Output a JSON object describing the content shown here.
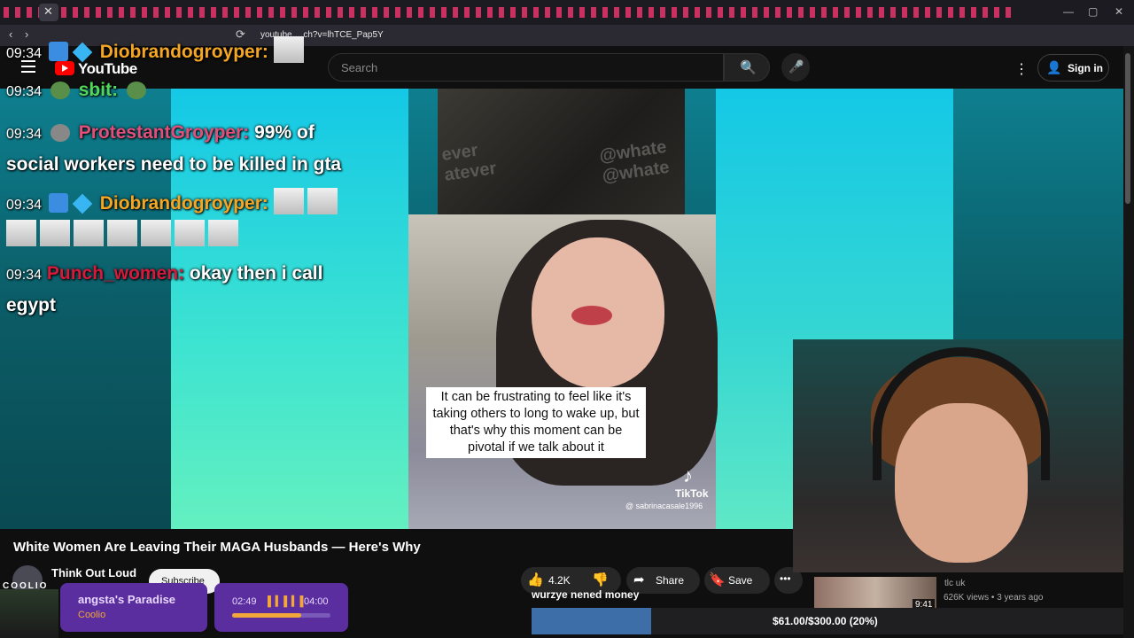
{
  "browser": {
    "url": "youtube.…ch?v=lhTCE_Pap5Y",
    "close_glyph": "✕",
    "back_glyph": "‹",
    "forward_glyph": "›",
    "reload_glyph": "⟳",
    "min_glyph": "—",
    "max_glyph": "▢",
    "win_close_glyph": "✕"
  },
  "youtube": {
    "logo": "YouTube",
    "search_placeholder": "Search",
    "search_icon": "🔍",
    "mic_icon": "🎤",
    "more_icon": "⋮",
    "signin_label": "Sign in",
    "signin_icon": "👤"
  },
  "video": {
    "top_text_left": "ever\natever",
    "top_text_right": "@whate\n@whate",
    "caption": "It can be frustrating to feel like it's taking others to long to wake up, but that's why this moment can be pivotal if we talk about it",
    "tiktok_brand": "TikTok",
    "tiktok_glyph": "♪",
    "tiktok_handle": "@ sabrinacasale1996"
  },
  "chat": [
    {
      "time": "09:34",
      "user": "Diobrandogroyper:",
      "message": ""
    },
    {
      "time": "09:34",
      "user": "sbit:",
      "message": ""
    },
    {
      "time": "09:34",
      "user": "ProtestantGroyper:",
      "message": "99% of",
      "message2": "social workers need to be killed in gta"
    },
    {
      "time": "09:34",
      "user": "Diobrandogroyper:",
      "message": ""
    },
    {
      "time": "09:34",
      "user": "Punch_women:",
      "message": "okay then i call",
      "message2": "egypt"
    }
  ],
  "meta": {
    "title": "White Women Are Leaving Their MAGA Husbands — Here's Why",
    "channel": "Think Out Loud",
    "subscribe": "Subscribe",
    "likes": "4.2K",
    "like_icon": "👍",
    "dislike_icon": "👎",
    "share": "Share",
    "share_icon": "➦",
    "save": "Save",
    "save_icon": "🔖",
    "more_icon": "•••"
  },
  "related": {
    "duration": "9:41",
    "channel": "tlc uk",
    "stats": "626K views • 3 years ago"
  },
  "music": {
    "cover_tag": "COOLIO",
    "song": "angsta's Paradise",
    "artist": "Coolio",
    "elapsed": "02:49",
    "total": "04:00",
    "wave": "▌▍▌▍▌",
    "progress": 0.7
  },
  "goal": {
    "name": "wurzye nened money",
    "text": "$61.00/$300.00 (20%)",
    "fraction": 0.2
  }
}
